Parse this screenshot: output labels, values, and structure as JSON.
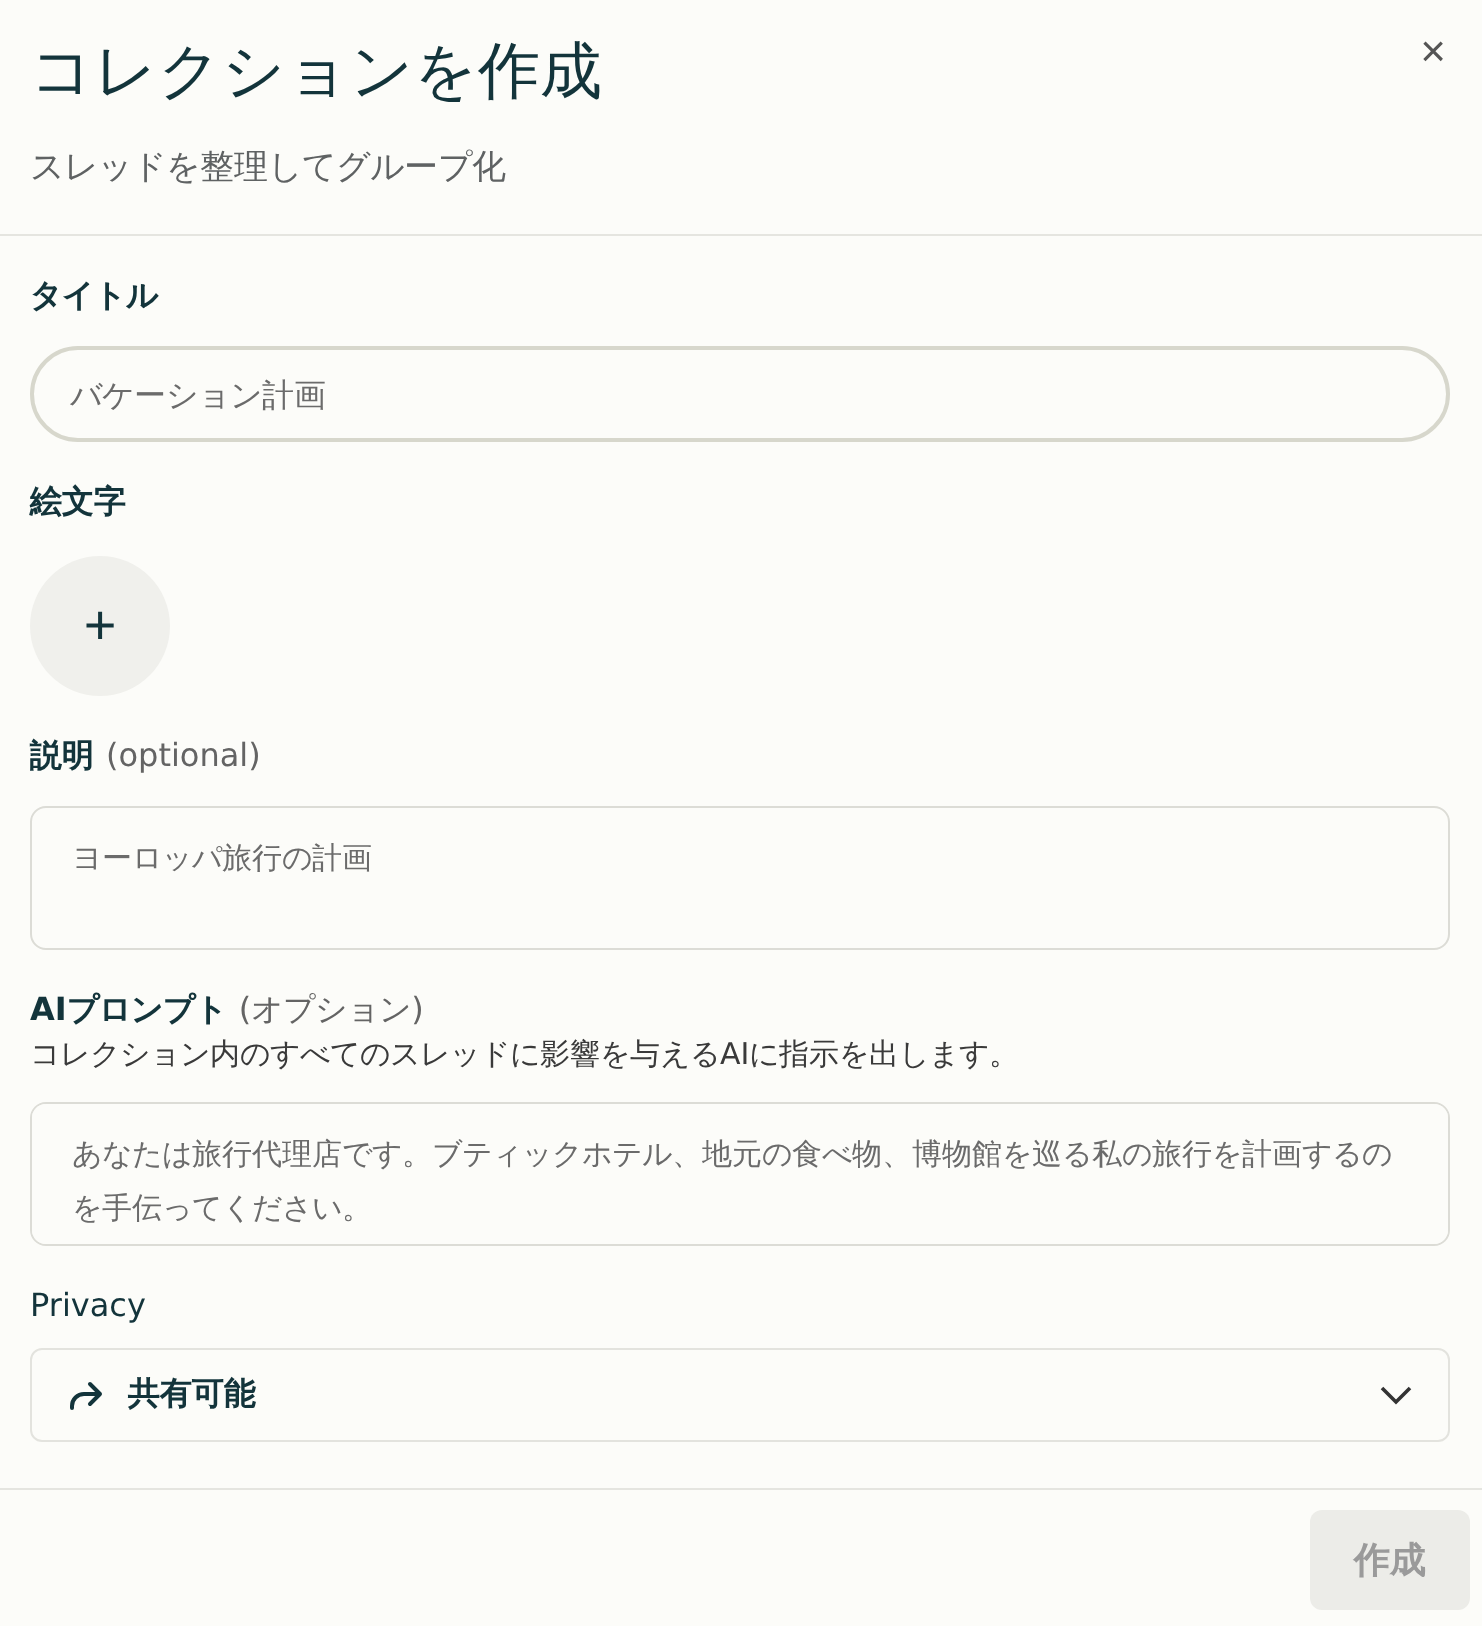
{
  "dialog": {
    "title": "コレクションを作成",
    "subtitle": "スレッドを整理してグループ化",
    "close": "×"
  },
  "fields": [
    {
      "kind": "text",
      "label": "タイトル",
      "placeholder": "バケーション計画",
      "focused": true
    },
    {
      "kind": "emoji",
      "label": "絵文字",
      "button": "+"
    },
    {
      "kind": "textarea",
      "label": "説明",
      "hint": "(optional)",
      "placeholder": "ヨーロッパ旅行の計画"
    },
    {
      "kind": "textarea",
      "label": "AIプロンプト",
      "hint": "(オプション)",
      "description": "コレクション内のすべてのスレッドに影響を与えるAIに指示を出します。",
      "placeholder": "あなたは旅行代理店です。ブティックホテル、地元の食べ物、博物館を巡る私の旅行を計画するのを手伝ってください。"
    },
    {
      "kind": "select",
      "label": "Privacy",
      "value": "共有可能"
    }
  ],
  "footer": {
    "submit": {
      "label": "作成",
      "disabled": true
    }
  }
}
